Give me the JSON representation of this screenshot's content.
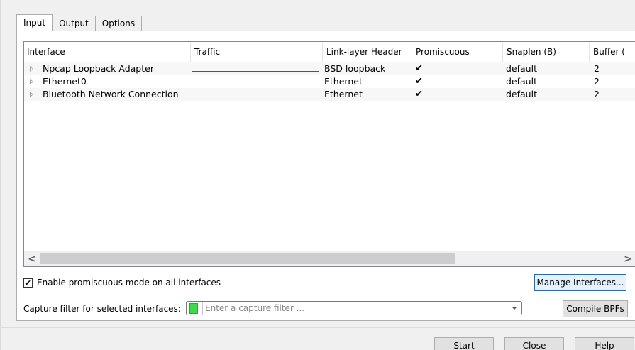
{
  "tabs": [
    {
      "label": "Input",
      "active": true
    },
    {
      "label": "Output",
      "active": false
    },
    {
      "label": "Options",
      "active": false
    }
  ],
  "interface_table": {
    "columns": [
      "Interface",
      "Traffic",
      "Link-layer Header",
      "Promiscuous",
      "Snaplen (B)",
      "Buffer ("
    ],
    "rows": [
      {
        "interface": "Npcap Loopback Adapter",
        "link_layer": "BSD loopback",
        "promiscuous": true,
        "snaplen": "default",
        "buffer": "2"
      },
      {
        "interface": "Ethernet0",
        "link_layer": "Ethernet",
        "promiscuous": true,
        "snaplen": "default",
        "buffer": "2"
      },
      {
        "interface": "Bluetooth Network Connection",
        "link_layer": "Ethernet",
        "promiscuous": true,
        "snaplen": "default",
        "buffer": "2"
      }
    ],
    "check_glyph": "✔"
  },
  "scrollbar": {
    "left_arrow": "<",
    "right_arrow": ">"
  },
  "promiscuous_all": {
    "label": "Enable promiscuous mode on all interfaces",
    "checked": true,
    "glyph": "✔"
  },
  "manage_interfaces_label": "Manage Interfaces...",
  "capture_filter": {
    "label": "Capture filter for selected interfaces:",
    "placeholder": "Enter a capture filter ...",
    "bookmark_color": "#3fd94a"
  },
  "compile_bpfs_label": "Compile BPFs",
  "dialog_buttons": {
    "start": "Start",
    "close": "Close",
    "help": "Help"
  }
}
